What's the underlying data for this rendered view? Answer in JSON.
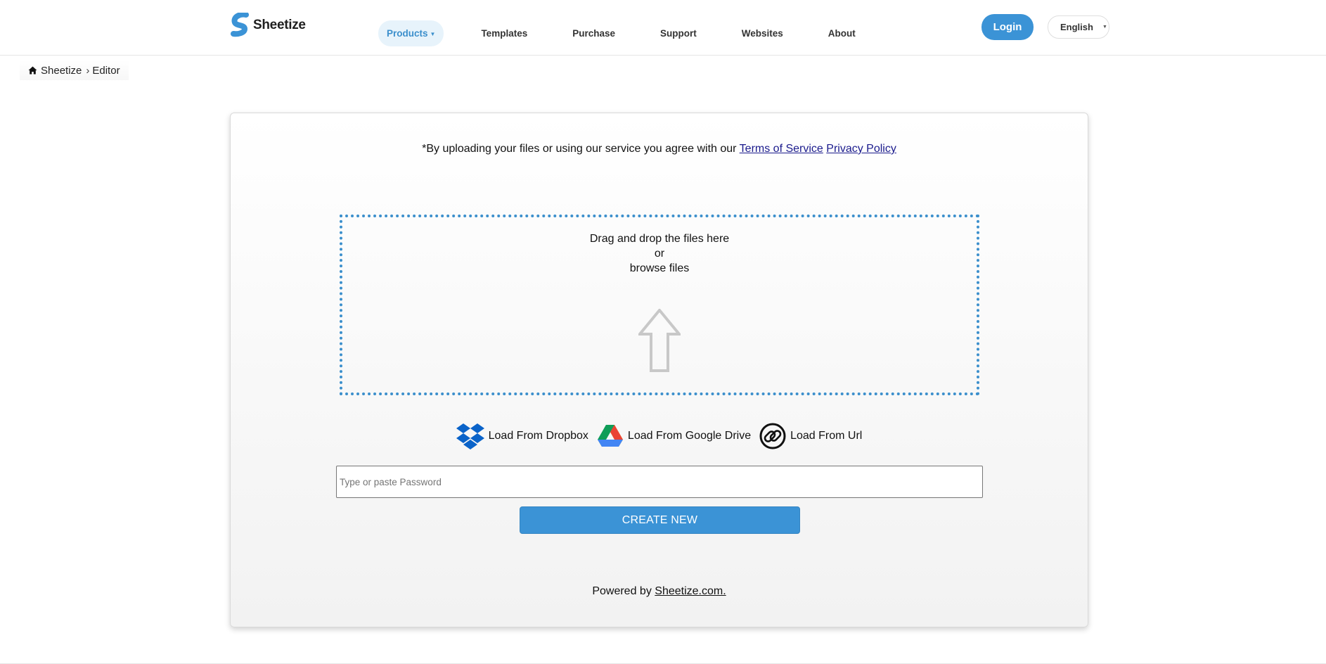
{
  "header": {
    "logo_text": "Sheetize",
    "nav": [
      {
        "label": "Products",
        "active": true,
        "has_dropdown": true
      },
      {
        "label": "Templates"
      },
      {
        "label": "Purchase"
      },
      {
        "label": "Support"
      },
      {
        "label": "Websites"
      },
      {
        "label": "About"
      }
    ],
    "login_label": "Login",
    "language": "English"
  },
  "breadcrumb": {
    "home": "Sheetize",
    "current": "Editor"
  },
  "main": {
    "terms_prefix": "*By uploading your files or using our service you agree with our ",
    "terms_link": "Terms of Service",
    "privacy_link": "Privacy Policy",
    "dropzone": {
      "line1": "Drag and drop the files here",
      "line2": "or",
      "line3": "browse files"
    },
    "sources": [
      {
        "label": "Load From Dropbox",
        "icon": "dropbox-icon"
      },
      {
        "label": "Load From Google Drive",
        "icon": "google-drive-icon"
      },
      {
        "label": "Load From Url",
        "icon": "link-icon"
      }
    ],
    "password_placeholder": "Type or paste Password",
    "create_label": "CREATE NEW",
    "powered_prefix": "Powered by ",
    "powered_link": "Sheetize.com."
  },
  "colors": {
    "accent": "#3b93d6",
    "dropzone_border": "#3b8fcc",
    "nav_active_bg": "#e7f3fb"
  }
}
